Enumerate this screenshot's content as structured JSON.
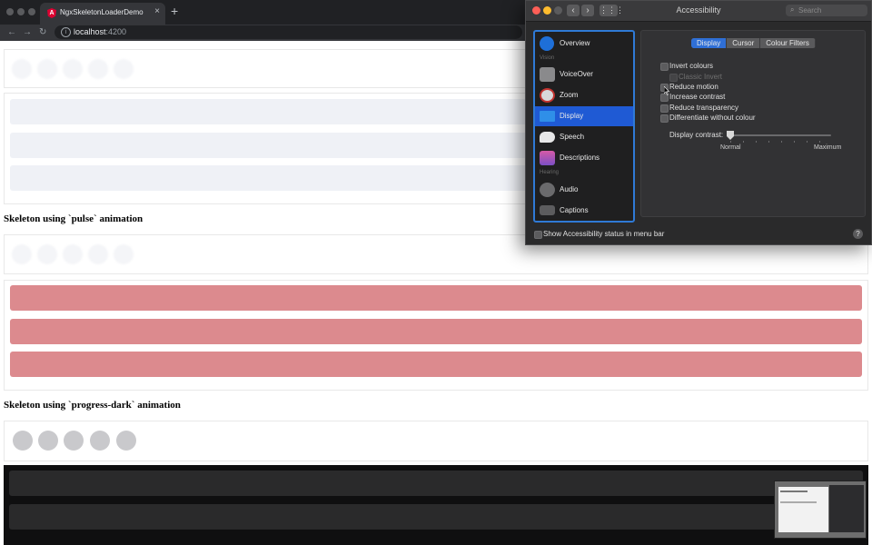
{
  "browser": {
    "tab_title": "NgxSkeletonLoaderDemo",
    "tab_close": "×",
    "new_tab": "+",
    "favicon_letter": "A",
    "url_host": "localhost",
    "url_port": ":4200",
    "nav_back": "←",
    "nav_forward": "→",
    "nav_reload": "↻",
    "info_glyph": "i"
  },
  "page": {
    "heading_pulse": "Skeleton using `pulse` animation",
    "heading_progress_dark": "Skeleton using `progress-dark` animation",
    "pulse_color": "#dc8a8e",
    "skeleton_color": "#eff1f6"
  },
  "accessibility": {
    "window_title": "Accessibility",
    "search_placeholder": "Search",
    "search_glyph": "⌕",
    "back_glyph": "‹",
    "forward_glyph": "›",
    "grid_glyph": "⋮⋮⋮",
    "sidebar": {
      "overview": "Overview",
      "section_vision": "Vision",
      "voiceover": "VoiceOver",
      "zoom": "Zoom",
      "display": "Display",
      "speech": "Speech",
      "descriptions": "Descriptions",
      "section_hearing": "Hearing",
      "audio": "Audio",
      "captions": "Captions"
    },
    "tabs": {
      "display": "Display",
      "cursor": "Cursor",
      "colour_filters": "Colour Filters"
    },
    "options": {
      "invert_colours": "Invert colours",
      "classic_invert": "Classic Invert",
      "reduce_motion": "Reduce motion",
      "increase_contrast": "Increase contrast",
      "reduce_transparency": "Reduce transparency",
      "differentiate_without_colour": "Differentiate without colour"
    },
    "display_contrast": {
      "label": "Display contrast:",
      "min_label": "Normal",
      "max_label": "Maximum",
      "value": 0
    },
    "menu_bar_status": "Show Accessibility status in menu bar",
    "help": "?",
    "accent_color": "#2f6fd6"
  }
}
